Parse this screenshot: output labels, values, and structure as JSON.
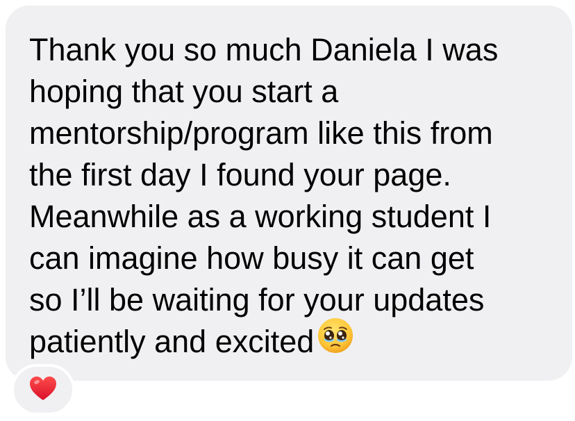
{
  "message": {
    "lines": [
      "Thank you so much Daniela I was",
      "hoping that you start a",
      "mentorship/program like this from",
      "the first day I found your page.",
      "Meanwhile as a working student I",
      "can imagine how busy it can get",
      "so I’ll be waiting for your updates",
      "patiently and excited"
    ],
    "trailing_emoji": "pleading-face-emoji"
  },
  "reaction": {
    "icon": "red-heart-icon",
    "color": "#e8202f"
  },
  "colors": {
    "bubble_background": "#f0f0f2",
    "text": "#000000",
    "page_background": "#ffffff"
  }
}
